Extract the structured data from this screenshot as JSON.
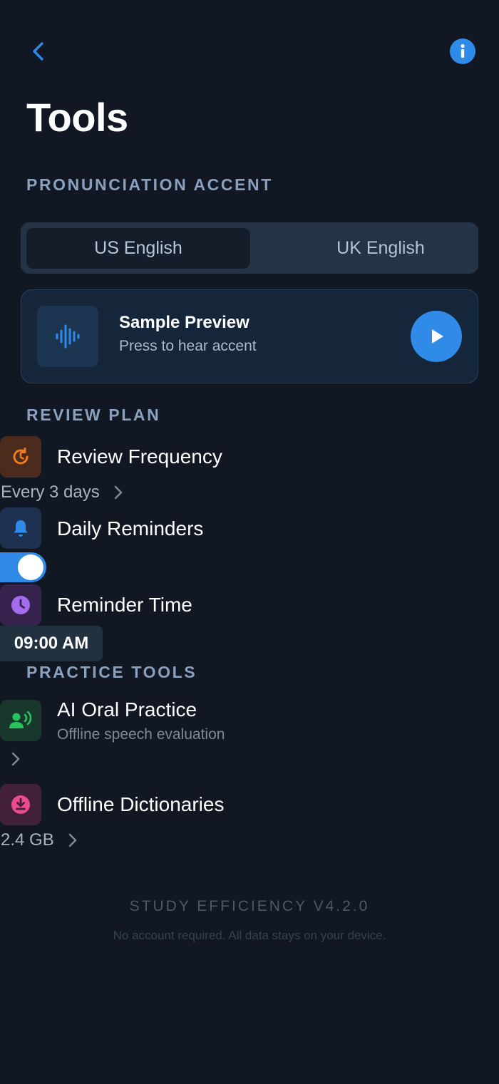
{
  "header": {
    "title": "Tools",
    "back_icon": "chevron-left-icon",
    "info_icon": "info-icon"
  },
  "pronunciation": {
    "section_label": "PRONUNCIATION ACCENT",
    "options": [
      "US English",
      "UK English"
    ],
    "selected": "US English",
    "preview": {
      "title": "Sample Preview",
      "subtitle": "Press to hear accent",
      "icon": "audio-wave-icon",
      "play_icon": "play-icon"
    }
  },
  "review_plan": {
    "section_label": "REVIEW PLAN",
    "frequency": {
      "label": "Review Frequency",
      "value": "Every 3 days",
      "icon": "refresh-clock-icon",
      "icon_color": "#f07a1c"
    },
    "reminders": {
      "label": "Daily Reminders",
      "enabled": true,
      "icon": "bell-icon",
      "icon_color": "#2f8ae8"
    },
    "reminder_time": {
      "label": "Reminder Time",
      "value": "09:00 AM",
      "icon": "clock-icon",
      "icon_color": "#a66cf0"
    }
  },
  "practice_tools": {
    "section_label": "PRACTICE TOOLS",
    "oral": {
      "label": "AI Oral Practice",
      "subtitle": "Offline speech evaluation",
      "icon": "speaking-person-icon",
      "icon_color": "#27c35c"
    },
    "dictionaries": {
      "label": "Offline Dictionaries",
      "value": "2.4 GB",
      "icon": "download-icon",
      "icon_color": "#ec4b8e"
    }
  },
  "footer": {
    "version": "STUDY EFFICIENCY V4.2.0",
    "note": "No account required. All data stays on your device."
  },
  "colors": {
    "background": "#111823",
    "accent": "#2f8ae8",
    "section_label": "#8aa0bd"
  }
}
